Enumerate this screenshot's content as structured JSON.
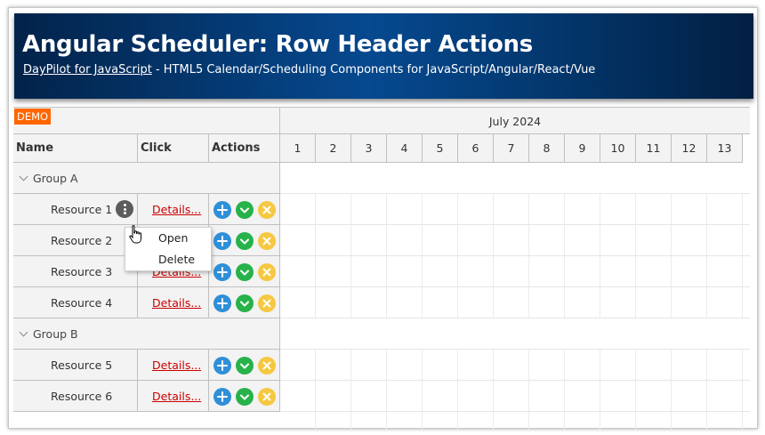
{
  "header": {
    "title": "Angular Scheduler: Row Header Actions",
    "link_text": "DayPilot for JavaScript",
    "subtitle_rest": " - HTML5 Calendar/Scheduling Components for JavaScript/Angular/React/Vue"
  },
  "scheduler": {
    "demo_badge": "DEMO",
    "columns": {
      "name": "Name",
      "click": "Click",
      "actions": "Actions"
    },
    "month": "July 2024",
    "days": [
      "1",
      "2",
      "3",
      "4",
      "5",
      "6",
      "7",
      "8",
      "9",
      "10",
      "11",
      "12",
      "13"
    ],
    "rows": [
      {
        "type": "group",
        "label": "Group A"
      },
      {
        "type": "resource",
        "label": "Resource 1",
        "details": "Details...",
        "menu_open": true
      },
      {
        "type": "resource",
        "label": "Resource 2",
        "details": "Details..."
      },
      {
        "type": "resource",
        "label": "Resource 3",
        "details": "Details..."
      },
      {
        "type": "resource",
        "label": "Resource 4",
        "details": "Details..."
      },
      {
        "type": "group",
        "label": "Group B"
      },
      {
        "type": "resource",
        "label": "Resource 5",
        "details": "Details..."
      },
      {
        "type": "resource",
        "label": "Resource 6",
        "details": "Details..."
      }
    ],
    "context_menu": [
      "Open",
      "Delete"
    ],
    "action_icons": [
      "add-icon",
      "check-icon",
      "delete-icon"
    ],
    "colors": {
      "add": "#2f8fd8",
      "ok": "#27b24a",
      "delete": "#f6c842",
      "demo": "#ff6600",
      "details": "#cc0000"
    }
  }
}
